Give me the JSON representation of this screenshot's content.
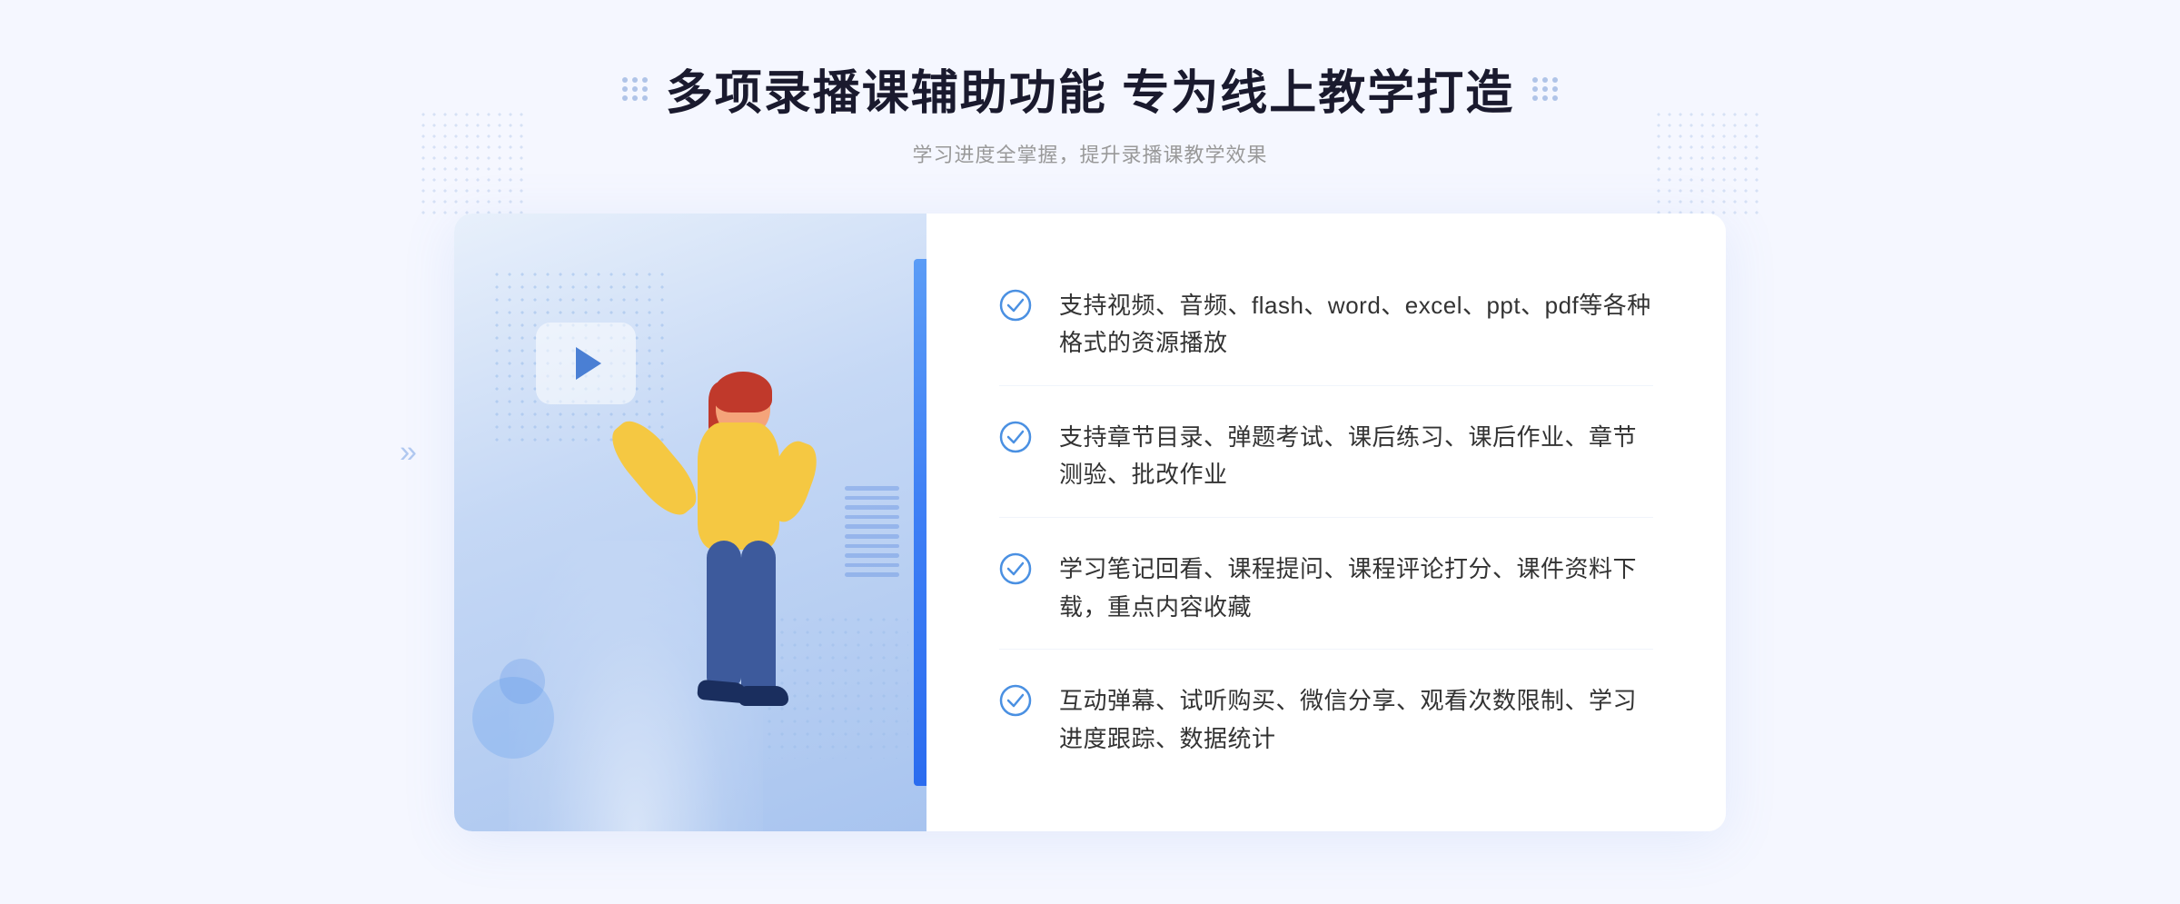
{
  "page": {
    "background": "#f5f7ff"
  },
  "header": {
    "title": "多项录播课辅助功能 专为线上教学打造",
    "subtitle": "学习进度全掌握，提升录播课教学效果",
    "title_dots_label": "decorative-dots"
  },
  "features": [
    {
      "id": 1,
      "text": "支持视频、音频、flash、word、excel、ppt、pdf等各种格式的资源播放"
    },
    {
      "id": 2,
      "text": "支持章节目录、弹题考试、课后练习、课后作业、章节测验、批改作业"
    },
    {
      "id": 3,
      "text": "学习笔记回看、课程提问、课程评论打分、课件资料下载，重点内容收藏"
    },
    {
      "id": 4,
      "text": "互动弹幕、试听购买、微信分享、观看次数限制、学习进度跟踪、数据统计"
    }
  ],
  "illustration": {
    "alt": "教学插图 - 老师指向屏幕"
  },
  "icons": {
    "check": "check-circle-icon",
    "play": "play-button-icon",
    "chevron": "chevron-right-icon"
  },
  "colors": {
    "accent": "#4a7fd4",
    "accent_light": "#5b9cf6",
    "text_primary": "#1a1a2e",
    "text_secondary": "#999999",
    "text_body": "#333333",
    "bg_page": "#f5f7ff",
    "bg_card": "#ffffff",
    "check_color": "#4a90e2"
  }
}
